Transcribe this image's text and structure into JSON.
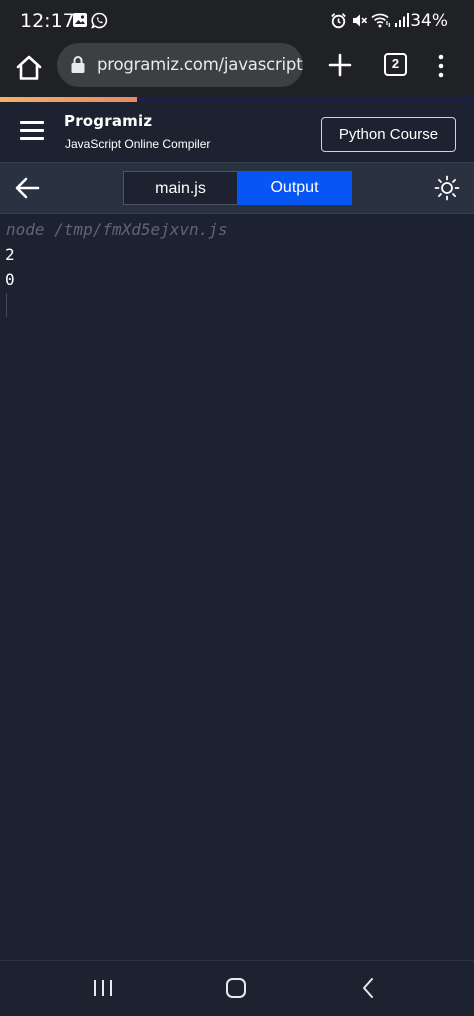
{
  "status_bar": {
    "time": "12:17",
    "battery": "34%",
    "icons": [
      "gallery-icon",
      "whatsapp-icon",
      "alarm-icon",
      "mute-icon",
      "wifi-icon",
      "signal-icon"
    ]
  },
  "browser": {
    "url": "programiz.com/javascript/onli",
    "tab_count": "2",
    "page_load_progress": 0.29
  },
  "header": {
    "logo": "Programiz",
    "subtitle": "JavaScript Online Compiler",
    "course_button": "Python Course"
  },
  "toolbar": {
    "tabs": [
      {
        "label": "main.js",
        "active": false
      },
      {
        "label": "Output",
        "active": true
      }
    ]
  },
  "console": {
    "command": "node /tmp/fmXd5ejxvn.js",
    "lines": [
      "2",
      "0"
    ]
  },
  "colors": {
    "background": "#1c2230",
    "toolbar": "#2a3140",
    "accent_blue": "#0556f3",
    "progress": "#f3b067"
  }
}
